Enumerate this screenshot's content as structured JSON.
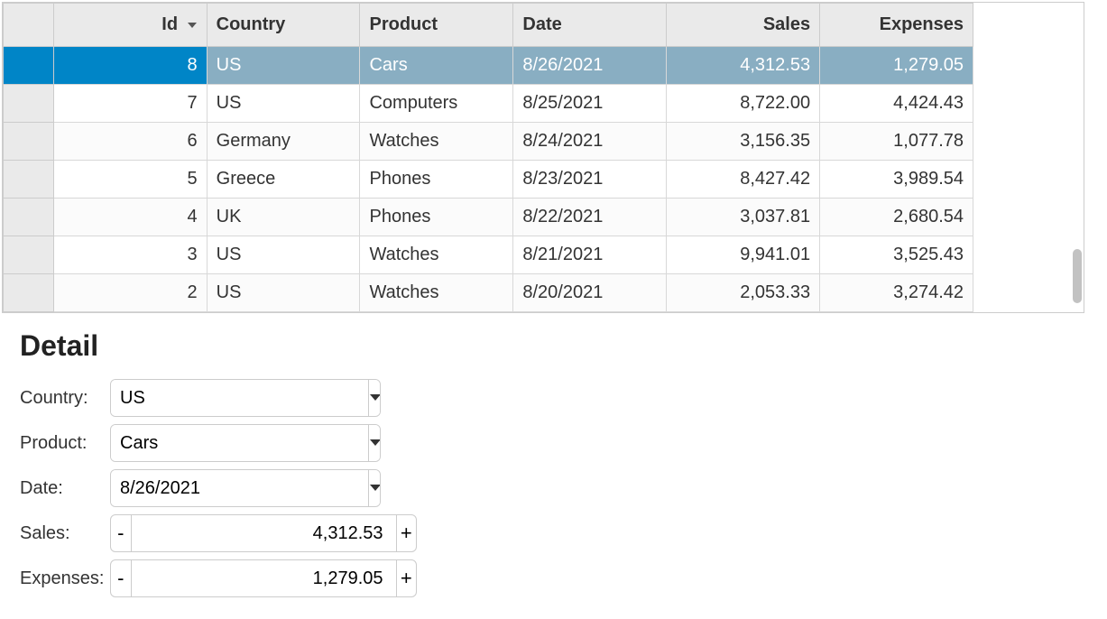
{
  "grid": {
    "columns": [
      {
        "key": "id",
        "label": "Id",
        "align": "right",
        "sorted": "desc"
      },
      {
        "key": "country",
        "label": "Country",
        "align": "left"
      },
      {
        "key": "product",
        "label": "Product",
        "align": "left"
      },
      {
        "key": "date",
        "label": "Date",
        "align": "left"
      },
      {
        "key": "sales",
        "label": "Sales",
        "align": "right"
      },
      {
        "key": "expenses",
        "label": "Expenses",
        "align": "right"
      }
    ],
    "rows": [
      {
        "id": "8",
        "country": "US",
        "product": "Cars",
        "date": "8/26/2021",
        "sales": "4,312.53",
        "expenses": "1,279.05",
        "selected": true
      },
      {
        "id": "7",
        "country": "US",
        "product": "Computers",
        "date": "8/25/2021",
        "sales": "8,722.00",
        "expenses": "4,424.43"
      },
      {
        "id": "6",
        "country": "Germany",
        "product": "Watches",
        "date": "8/24/2021",
        "sales": "3,156.35",
        "expenses": "1,077.78"
      },
      {
        "id": "5",
        "country": "Greece",
        "product": "Phones",
        "date": "8/23/2021",
        "sales": "8,427.42",
        "expenses": "3,989.54"
      },
      {
        "id": "4",
        "country": "UK",
        "product": "Phones",
        "date": "8/22/2021",
        "sales": "3,037.81",
        "expenses": "2,680.54"
      },
      {
        "id": "3",
        "country": "US",
        "product": "Watches",
        "date": "8/21/2021",
        "sales": "9,941.01",
        "expenses": "3,525.43"
      },
      {
        "id": "2",
        "country": "US",
        "product": "Watches",
        "date": "8/20/2021",
        "sales": "2,053.33",
        "expenses": "3,274.42"
      }
    ]
  },
  "detail": {
    "title": "Detail",
    "labels": {
      "country": "Country:",
      "product": "Product:",
      "date": "Date:",
      "sales": "Sales:",
      "expenses": "Expenses:"
    },
    "values": {
      "country": "US",
      "product": "Cars",
      "date": "8/26/2021",
      "sales": "4,312.53",
      "expenses": "1,279.05"
    },
    "buttons": {
      "minus": "-",
      "plus": "+"
    }
  },
  "chart_data": {
    "type": "table",
    "columns": [
      "Id",
      "Country",
      "Product",
      "Date",
      "Sales",
      "Expenses"
    ],
    "rows": [
      [
        8,
        "US",
        "Cars",
        "8/26/2021",
        4312.53,
        1279.05
      ],
      [
        7,
        "US",
        "Computers",
        "8/25/2021",
        8722.0,
        4424.43
      ],
      [
        6,
        "Germany",
        "Watches",
        "8/24/2021",
        3156.35,
        1077.78
      ],
      [
        5,
        "Greece",
        "Phones",
        "8/23/2021",
        8427.42,
        3989.54
      ],
      [
        4,
        "UK",
        "Phones",
        "8/22/2021",
        3037.81,
        2680.54
      ],
      [
        3,
        "US",
        "Watches",
        "8/21/2021",
        9941.01,
        3525.43
      ],
      [
        2,
        "US",
        "Watches",
        "8/20/2021",
        2053.33,
        3274.42
      ]
    ]
  }
}
